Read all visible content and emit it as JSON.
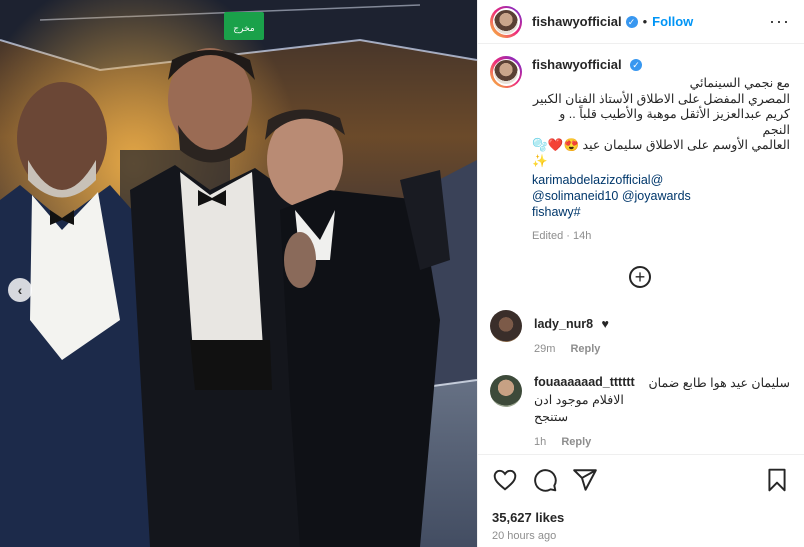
{
  "post": {
    "username": "fishawyofficial",
    "separator": "•",
    "follow_label": "Follow",
    "more_icon": "more-horizontal-icon",
    "caption_lines": [
      "مع نجمي السينمائي",
      "المصري المفضل على الاطلاق الأستاذ الفنان الكبير",
      "كريم عبدالعزيز الأثقل موهبة والأطيب قلباً .. و النجم",
      "العالمي الأوسم على الاطلاق سليمان عيد 😍❤️🫧",
      "✨"
    ],
    "mentions": [
      "karimabdelazizofficial@",
      "@solimaneid10 @joyawards",
      "fishawy#"
    ],
    "edited": "Edited · 14h"
  },
  "comments": [
    {
      "username": "lady_nur8",
      "text": "♥",
      "time": "29m",
      "reply": "Reply"
    },
    {
      "username": "fouaaaaaad_tttttt",
      "text_lines": [
        "سليمان عيد هوا طابع ضمان",
        "الافلام موجود ادن ستنجح"
      ],
      "time": "1h",
      "reply": "Reply"
    }
  ],
  "footer": {
    "likes": "35,627 likes",
    "ago": "20 hours ago"
  },
  "photo": {
    "exit_sign": "مخرج",
    "prev_icon": "chevron-left-icon"
  },
  "colors": {
    "link": "#0095f6",
    "mention": "#00376b",
    "muted": "#8e8e8e"
  }
}
